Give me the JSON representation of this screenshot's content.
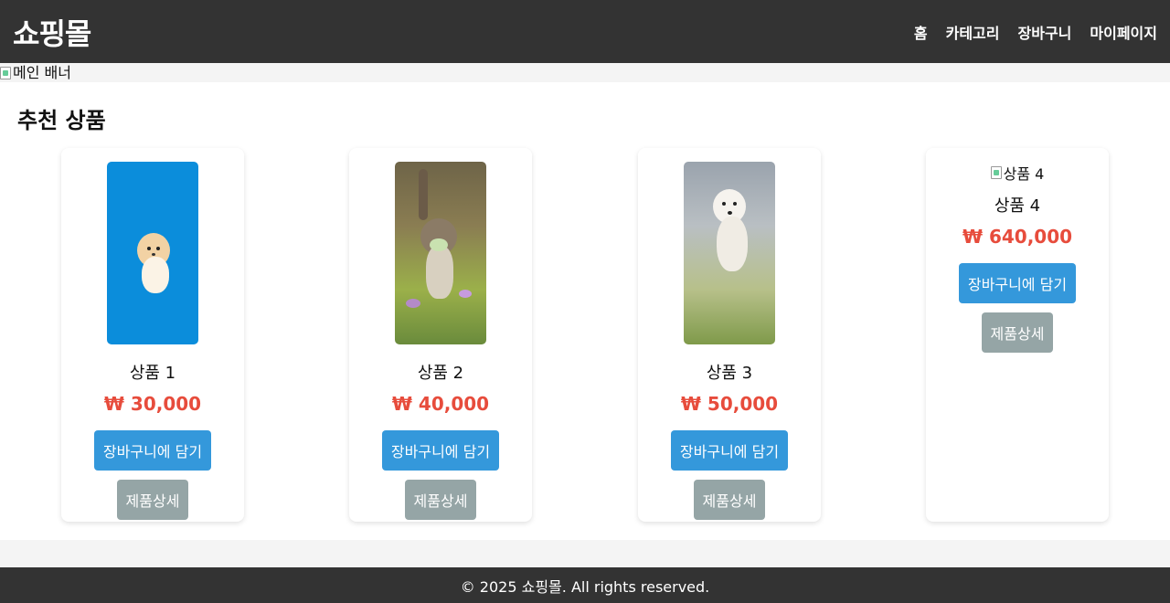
{
  "header": {
    "logo": "쇼핑몰",
    "nav": [
      "홈",
      "카테고리",
      "장바구니",
      "마이페이지"
    ]
  },
  "banner": {
    "alt": "메인 배너"
  },
  "section": {
    "title": "추천 상품"
  },
  "products": [
    {
      "name": "상품 1",
      "price": "₩ 30,000",
      "cart_label": "장바구니에 담기",
      "detail_label": "제품상세",
      "image": "pomeranian-photo"
    },
    {
      "name": "상품 2",
      "price": "₩ 40,000",
      "cart_label": "장바구니에 담기",
      "detail_label": "제품상세",
      "image": "cat-photo"
    },
    {
      "name": "상품 3",
      "price": "₩ 50,000",
      "cart_label": "장바구니에 담기",
      "detail_label": "제품상세",
      "image": "white-dog-photo"
    },
    {
      "name": "상품 4",
      "price": "₩ 640,000",
      "cart_label": "장바구니에 담기",
      "detail_label": "제품상세",
      "image_alt": "상품 4"
    }
  ],
  "footer": {
    "text": "© 2025 쇼핑몰. All rights reserved."
  },
  "colors": {
    "header_bg": "#333333",
    "price": "#e74c3c",
    "cart_button": "#3498db",
    "detail_button": "#95a5a6"
  }
}
